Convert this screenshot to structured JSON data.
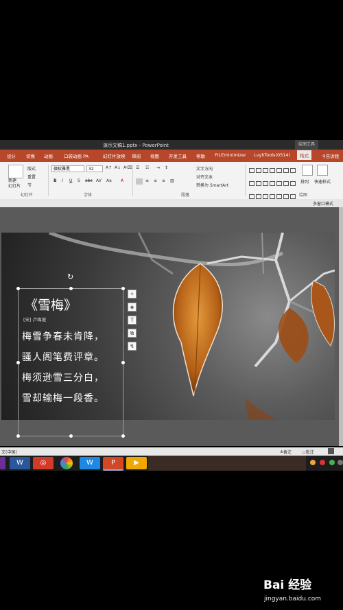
{
  "window": {
    "title": "演示文稿1.pptx - PowerPoint",
    "contextual_tab_group": "绘图工具"
  },
  "tabs": [
    "设计",
    "切换",
    "动画",
    "口袋动画 PA",
    "幻灯片放映",
    "审阅",
    "视图",
    "开发工具",
    "帮助",
    "FILEminimizer",
    "LvyhTools(0514)",
    "格式"
  ],
  "tell_me": "告诉我",
  "ribbon": {
    "slides_group": {
      "label": "幻灯片",
      "new_slide": "新建\n幻灯片",
      "layout": "版式",
      "reset": "重置",
      "section": "节"
    },
    "font_group": {
      "label": "字体",
      "font_name": "微软雅黑",
      "font_size": "32"
    },
    "paragraph_group": {
      "label": "段落",
      "text_direction": "文字方向",
      "align_text": "对齐文本",
      "convert_smartart": "转换为 SmartArt"
    },
    "drawing_group": {
      "label": "绘图",
      "arrange": "排列",
      "quick_styles": "快速样式"
    }
  },
  "thumb_bar": {
    "multi_window": "多窗口模式"
  },
  "slide": {
    "poem_title": "《雪梅》",
    "poem_author": "[宋] 卢梅坡",
    "poem_lines": [
      "梅雪争春未肯降，",
      "骚人阁笔费评章。",
      "梅须逊雪三分白，",
      "雪却输梅一段香。"
    ]
  },
  "status_bar": {
    "language": "文(中国)",
    "notes": "备注",
    "comments": "批注"
  },
  "watermark": {
    "logo": "Bai 经验",
    "url": "jingyan.baidu.com"
  },
  "colors": {
    "accent": "#b7472a",
    "ribbon_bg": "#f3f3f3",
    "canvas_bg": "#5a5a5a",
    "leaf": "#c4731e"
  },
  "icons": {
    "floating_toolbar": [
      "layout-options-icon",
      "animation-icon",
      "text-icon",
      "crop-icon",
      "rotate-icon"
    ]
  }
}
